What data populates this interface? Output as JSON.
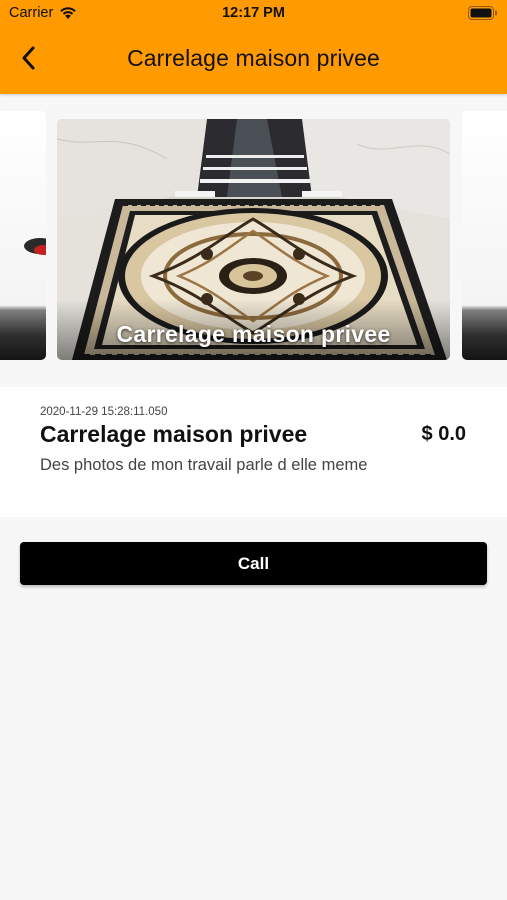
{
  "status_bar": {
    "carrier": "Carrier",
    "time": "12:17 PM",
    "wifi_icon": "wifi-icon",
    "battery_icon": "battery-icon"
  },
  "nav": {
    "back_icon": "chevron-left-icon",
    "title": "Carrelage maison privee"
  },
  "carousel": {
    "slides": [
      {
        "caption": "Carrelage maison privee",
        "image": "marble floor medallion tile photo"
      }
    ]
  },
  "item": {
    "timestamp": "2020-11-29 15:28:11.050",
    "title": "Carrelage maison privee",
    "price": "$ 0.0",
    "description": "Des photos de mon travail parle d elle meme"
  },
  "actions": {
    "call_label": "Call"
  },
  "colors": {
    "header_bg": "#ff9a00",
    "button_bg": "#000000",
    "page_bg": "#f7f7f7"
  }
}
